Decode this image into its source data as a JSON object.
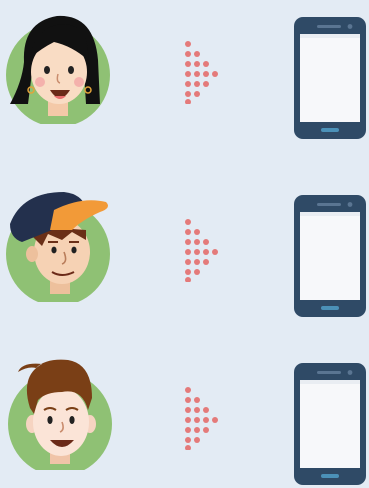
{
  "colors": {
    "background": "#e3ebf4",
    "avatar_circle": "#8fc174",
    "arrow_dots": "#e47a7a",
    "phone_body": "#2f4a66",
    "phone_screen": "#f7f8fa",
    "cap_navy": "#23304d",
    "cap_orange": "#f29a38"
  },
  "rows": [
    {
      "avatar": "woman-black-hair-avatar",
      "arrow": "dotted-arrow-icon",
      "device": "smartphone-icon"
    },
    {
      "avatar": "man-cap-avatar",
      "arrow": "dotted-arrow-icon",
      "device": "smartphone-icon"
    },
    {
      "avatar": "man-brown-hair-avatar",
      "arrow": "dotted-arrow-icon",
      "device": "smartphone-icon"
    }
  ]
}
